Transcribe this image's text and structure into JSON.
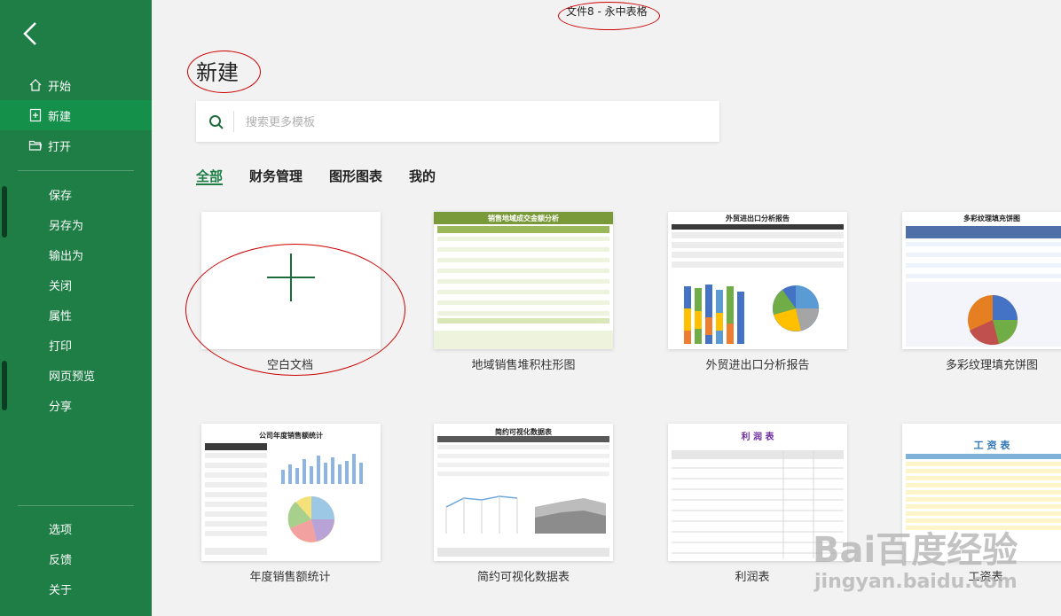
{
  "window": {
    "title": "文件8 - 永中表格"
  },
  "sidebar": {
    "nav": [
      {
        "label": "开始",
        "icon": "home-icon"
      },
      {
        "label": "新建",
        "icon": "new-file-icon"
      },
      {
        "label": "打开",
        "icon": "open-folder-icon"
      }
    ],
    "actions": [
      "保存",
      "另存为",
      "输出为",
      "关闭",
      "属性",
      "打印",
      "网页预览",
      "分享"
    ],
    "footer": [
      "选项",
      "反馈",
      "关于"
    ]
  },
  "page": {
    "heading": "新建",
    "search": {
      "placeholder": "搜索更多模板",
      "value": ""
    },
    "tabs": [
      "全部",
      "财务管理",
      "图形图表",
      "我的"
    ]
  },
  "templates": [
    {
      "label": "空白文档"
    },
    {
      "label": "地域销售堆积柱形图",
      "thumb_title": "销售地域成交金额分析"
    },
    {
      "label": "外贸进出口分析报告",
      "thumb_title": "外贸进出口分析报告"
    },
    {
      "label": "多彩纹理填充饼图",
      "thumb_title": "多彩纹理填充饼图"
    },
    {
      "label": "年度销售额统计",
      "thumb_title": "公司年度销售额统计"
    },
    {
      "label": "简约可视化数据表",
      "thumb_title": "简约可视化数据表"
    },
    {
      "label": "利润表",
      "thumb_title": "利 润 表"
    },
    {
      "label": "工资表",
      "thumb_title": "工 资 表"
    }
  ],
  "watermark": {
    "brand": "Bai百度经验",
    "url": "jingyan.baidu.com"
  },
  "colors": {
    "sidebar": "#1e7e45",
    "accent": "#1e7e45",
    "annotation": "#cc0000"
  }
}
